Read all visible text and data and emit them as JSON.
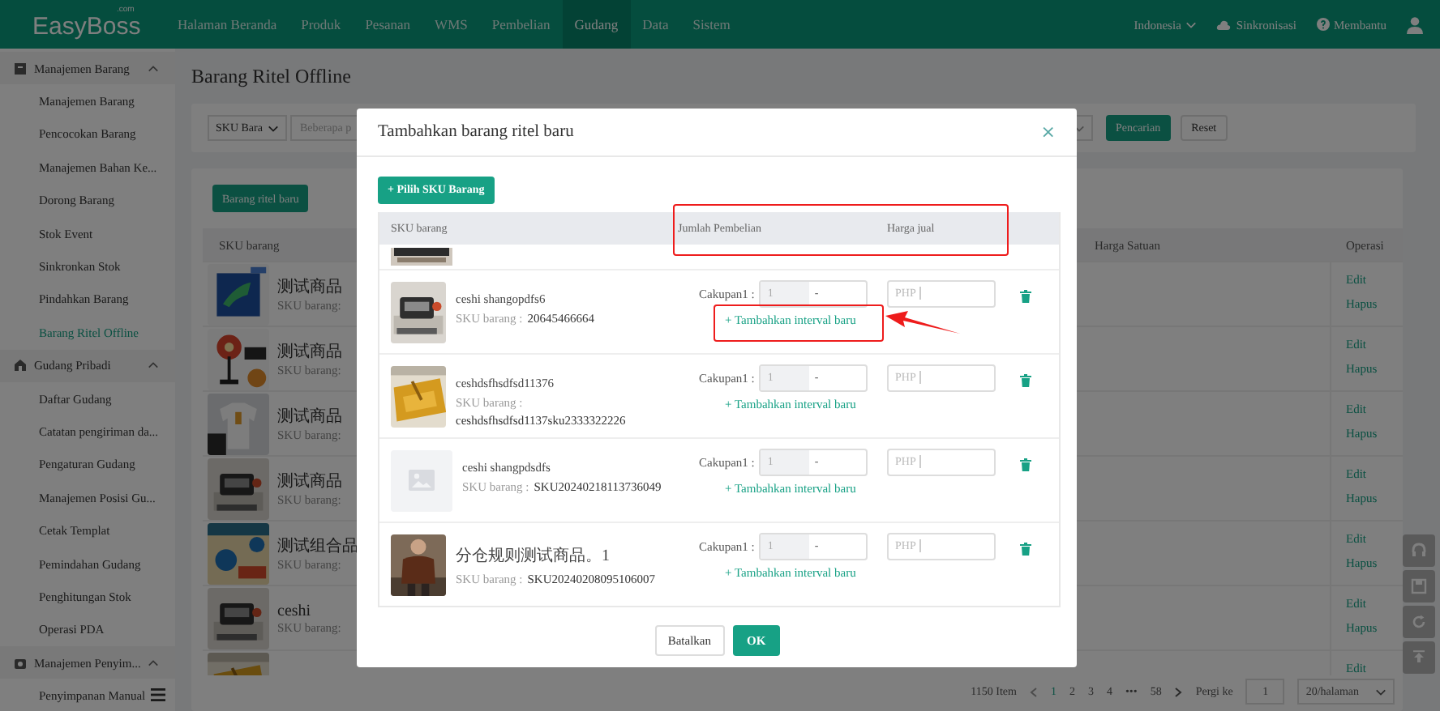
{
  "nav": {
    "logo": "EasyBoss",
    "logo_suffix": ".com",
    "menu": [
      {
        "label": "Halaman Beranda",
        "selected": false
      },
      {
        "label": "Produk",
        "selected": false
      },
      {
        "label": "Pesanan",
        "selected": false
      },
      {
        "label": "WMS",
        "selected": false
      },
      {
        "label": "Pembelian",
        "selected": false
      },
      {
        "label": "Gudang",
        "selected": true
      },
      {
        "label": "Data",
        "selected": false
      },
      {
        "label": "Sistem",
        "selected": false
      }
    ],
    "language": "Indonesia",
    "sync": "Sinkronisasi",
    "help": "Membantu"
  },
  "sidebar": {
    "groups": [
      {
        "label": "Manajemen Barang",
        "expanded": true,
        "items": [
          {
            "label": "Manajemen Barang",
            "selected": false
          },
          {
            "label": "Pencocokan Barang",
            "selected": false
          },
          {
            "label": "Manajemen Bahan Ke...",
            "selected": false
          },
          {
            "label": "Dorong Barang",
            "selected": false
          },
          {
            "label": "Stok Event",
            "selected": false
          },
          {
            "label": "Sinkronkan Stok",
            "selected": false
          },
          {
            "label": "Pindahkan Barang",
            "selected": false
          },
          {
            "label": "Barang Ritel Offline",
            "selected": true
          }
        ]
      },
      {
        "label": "Gudang Pribadi",
        "expanded": true,
        "items": [
          {
            "label": "Daftar Gudang",
            "selected": false
          },
          {
            "label": "Catatan pengiriman da...",
            "selected": false
          },
          {
            "label": "Pengaturan Gudang",
            "selected": false
          },
          {
            "label": "Manajemen Posisi Gu...",
            "selected": false
          },
          {
            "label": "Cetak Templat",
            "selected": false
          },
          {
            "label": "Pemindahan Gudang",
            "selected": false
          },
          {
            "label": "Penghitungan Stok",
            "selected": false
          },
          {
            "label": "Operasi PDA",
            "selected": false
          }
        ]
      },
      {
        "label": "Manajemen Penyim...",
        "expanded": true,
        "items": [
          {
            "label": "Penyimpanan Manual",
            "selected": false
          }
        ]
      }
    ]
  },
  "page": {
    "title": "Barang Ritel Offline",
    "filter": {
      "field_select": "SKU Bara",
      "keyword_placeholder": "Beberapa p",
      "search_button": "Pencarian",
      "reset_button": "Reset"
    },
    "new_button": "Barang ritel baru",
    "table": {
      "columns": [
        "SKU barang",
        "Harga Satuan",
        "Operasi"
      ],
      "rows": [
        {
          "name": "测试商品",
          "sku_label": "SKU barang:",
          "actions": [
            "Edit",
            "Hapus"
          ]
        },
        {
          "name": "测试商品",
          "sku_label": "SKU barang:",
          "actions": [
            "Edit",
            "Hapus"
          ]
        },
        {
          "name": "测试商品",
          "sku_label": "SKU barang:",
          "actions": [
            "Edit",
            "Hapus"
          ]
        },
        {
          "name": "测试商品",
          "sku_label": "SKU barang:",
          "actions": [
            "Edit",
            "Hapus"
          ]
        },
        {
          "name": "测试组合品",
          "sku_label": "SKU barang:",
          "actions": [
            "Edit",
            "Hapus"
          ]
        },
        {
          "name": "ceshi",
          "sku_label": "SKU barang:",
          "actions": [
            "Edit",
            "Hapus"
          ]
        },
        {
          "actions": [
            "Edit"
          ]
        }
      ]
    },
    "pagination": {
      "total": "1150 Item",
      "pages": [
        {
          "label": "1",
          "selected": true
        },
        {
          "label": "2",
          "selected": false
        },
        {
          "label": "3",
          "selected": false
        },
        {
          "label": "4",
          "selected": false
        }
      ],
      "ellipsis": "•••",
      "last_pages": [
        {
          "label": "58",
          "selected": false
        }
      ],
      "goto_label": "Pergi ke",
      "goto_value": "1",
      "page_size": "20/halaman"
    }
  },
  "dialog": {
    "title": "Tambahkan barang ritel baru",
    "close": "×",
    "select_button": "+ Pilih SKU Barang",
    "columns": [
      "SKU barang",
      "Jumlah Pembelian",
      "Harga jual"
    ],
    "header_highlighted": true,
    "rows": [
      {
        "kind": "picture",
        "name": "ceshi shangopdfs6",
        "sku_label": "SKU barang :",
        "sku": "20645466664",
        "range_label": "Cakupan1 :",
        "qty_from": "1",
        "separator": "-",
        "price_prefix": "PHP",
        "add_link": "+ Tambahkan interval baru",
        "highlighted": true
      },
      {
        "kind": "picture",
        "name": "ceshdsfhsdfsd11376",
        "sku_label": "SKU barang :",
        "sku": "ceshdsfhsdfsd1137sku2333322226",
        "range_label": "Cakupan1 :",
        "qty_from": "1",
        "separator": "-",
        "price_prefix": "PHP",
        "add_link": "+ Tambahkan interval baru",
        "highlighted": false
      },
      {
        "kind": "placeholder",
        "name": "ceshi shangpdsdfs",
        "sku_label": "SKU barang :",
        "sku": "SKU20240218113736049",
        "range_label": "Cakupan1 :",
        "qty_from": "1",
        "separator": "-",
        "price_prefix": "PHP",
        "add_link": "+ Tambahkan interval baru",
        "highlighted": false
      },
      {
        "kind": "picture",
        "name": "分仓规则测试商品。1",
        "sku_label": "SKU barang :",
        "sku": "SKU20240208095106007",
        "range_label": "Cakupan1 :",
        "qty_from": "1",
        "separator": "-",
        "price_prefix": "PHP",
        "add_link": "+ Tambahkan interval baru",
        "highlighted": false
      }
    ],
    "cancel_button": "Batalkan",
    "ok_button": "OK"
  }
}
